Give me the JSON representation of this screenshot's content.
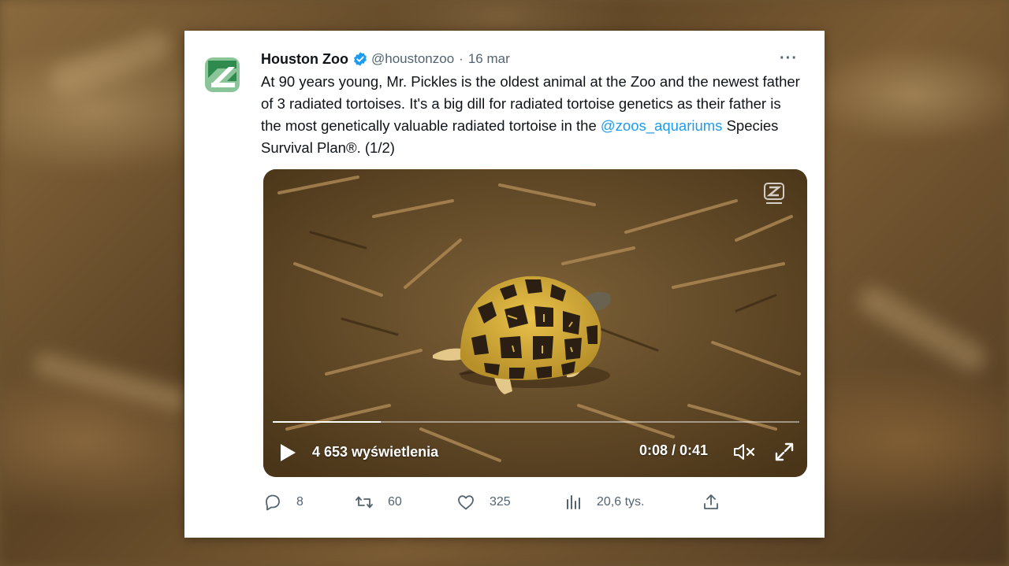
{
  "tweet": {
    "author_name": "Houston Zoo",
    "handle": "@houstonzoo",
    "separator": "·",
    "date": "16 mar",
    "more_label": "···",
    "text_part1": "At 90 years young, Mr. Pickles is the oldest animal at the Zoo and the newest father of 3 radiated tortoises. It's a big dill for radiated tortoise genetics as their father is the most genetically valuable radiated tortoise in the ",
    "mention": "@zoos_aquariums",
    "text_part2": " Species Survival Plan®. (1/2)"
  },
  "video": {
    "views": "4 653 wyświetlenia",
    "time": "0:08 / 0:41",
    "progress": 0.205
  },
  "actions": {
    "replies": "8",
    "retweets": "60",
    "likes": "325",
    "views": "20,6 tys."
  },
  "colors": {
    "accent": "#1d9bf0",
    "text_primary": "#0f1419",
    "text_secondary": "#536471",
    "logo_green": "#2f8a4e"
  },
  "icons": [
    "verified-badge-icon",
    "more-icon",
    "play-icon",
    "mute-icon",
    "fullscreen-icon",
    "reply-icon",
    "retweet-icon",
    "like-icon",
    "views-icon",
    "share-icon",
    "zoo-logo-icon"
  ]
}
